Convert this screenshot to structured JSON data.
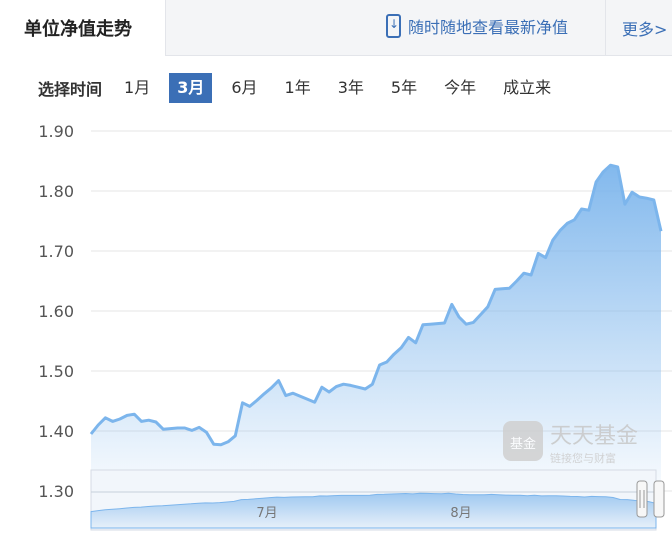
{
  "header": {
    "tab_label": "单位净值走势",
    "promo_text": "随时随地查看最新净值",
    "more_label": "更多>"
  },
  "range_selector": {
    "label": "选择时间",
    "options": [
      "1月",
      "3月",
      "6月",
      "1年",
      "3年",
      "5年",
      "今年",
      "成立来"
    ],
    "active": "3月"
  },
  "watermark": {
    "title": "天天基金",
    "subtitle": "链接您与财富",
    "badge": "基金"
  },
  "navigator": {
    "ticks": [
      "7月",
      "8月"
    ]
  },
  "colors": {
    "accent": "#3b6fb6",
    "line": "#7cb5ec"
  },
  "chart_data": {
    "type": "area",
    "title": "",
    "xlabel": "",
    "ylabel": "",
    "ylim": [
      1.3,
      1.9
    ],
    "yticks": [
      "1.90",
      "1.80",
      "1.70",
      "1.60",
      "1.50",
      "1.40",
      "1.30"
    ],
    "grid": true,
    "legend": "none",
    "series": [
      {
        "values": [
          1.395,
          1.41,
          1.422,
          1.416,
          1.42,
          1.426,
          1.428,
          1.416,
          1.418,
          1.415,
          1.403,
          1.404,
          1.405,
          1.405,
          1.401,
          1.406,
          1.398,
          1.378,
          1.377,
          1.382,
          1.392,
          1.447,
          1.441,
          1.451,
          1.462,
          1.472,
          1.484,
          1.459,
          1.463,
          1.458,
          1.453,
          1.448,
          1.473,
          1.465,
          1.474,
          1.478,
          1.476,
          1.473,
          1.47,
          1.478,
          1.51,
          1.515,
          1.528,
          1.539,
          1.556,
          1.547,
          1.577,
          1.578,
          1.579,
          1.58,
          1.611,
          1.59,
          1.578,
          1.581,
          1.594,
          1.607,
          1.636,
          1.637,
          1.638,
          1.65,
          1.663,
          1.66,
          1.696,
          1.689,
          1.718,
          1.734,
          1.746,
          1.752,
          1.77,
          1.768,
          1.815,
          1.832,
          1.843,
          1.84,
          1.778,
          1.798,
          1.79,
          1.788,
          1.785,
          1.733
        ]
      }
    ]
  }
}
